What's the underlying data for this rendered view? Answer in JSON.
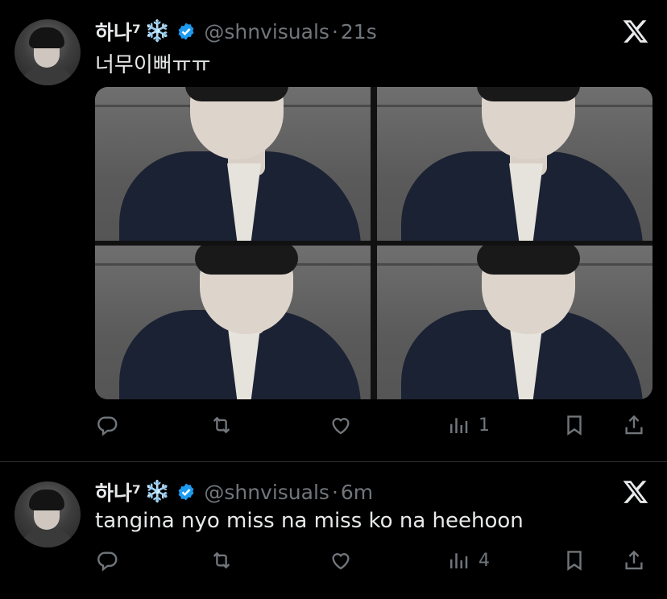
{
  "tweets": [
    {
      "display_name": "하나⁷",
      "emoji": "❄️",
      "handle": "@shnvisuals",
      "separator": "·",
      "time": "21s",
      "text": "너무이뻐ㅠㅠ",
      "views_count": "1"
    },
    {
      "display_name": "하나⁷",
      "emoji": "❄️",
      "handle": "@shnvisuals",
      "separator": "·",
      "time": "6m",
      "text": "tangina nyo miss na miss ko na heehoon",
      "views_count": "4"
    }
  ],
  "colors": {
    "background": "#000000",
    "primary_text": "#e7e9ea",
    "secondary_text": "#71767b",
    "verified_blue": "#1d9bf0",
    "divider": "#2f3336"
  },
  "icons": [
    "reply-icon",
    "retweet-icon",
    "like-icon",
    "views-icon",
    "bookmark-icon",
    "share-icon",
    "x-logo-icon",
    "verified-badge-icon",
    "snowflake-icon"
  ]
}
